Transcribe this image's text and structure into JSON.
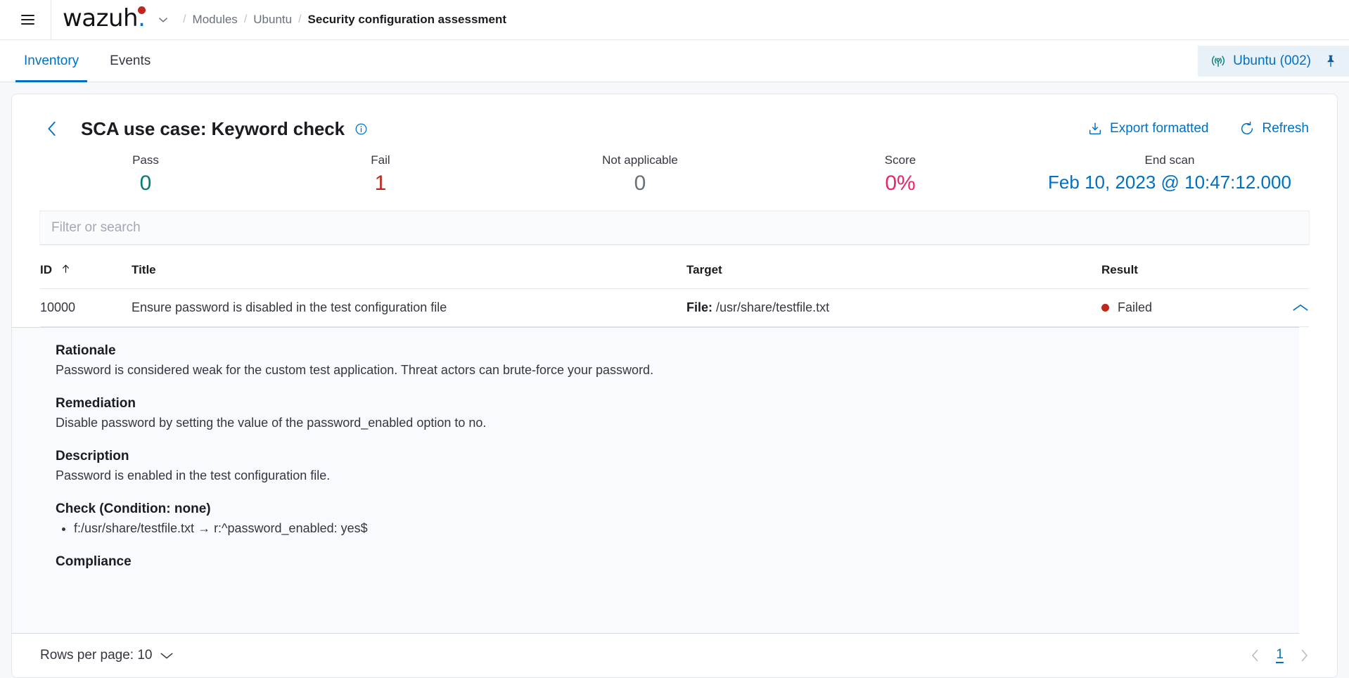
{
  "topbar": {
    "menu_icon": "hamburger-icon",
    "brand": "wazuh",
    "brand_dot": ".",
    "brand_caret_icon": "chevron-down-icon",
    "breadcrumbs": [
      {
        "label": "Modules",
        "current": false
      },
      {
        "label": "Ubuntu",
        "current": false
      },
      {
        "label": "Security configuration assessment",
        "current": true
      }
    ],
    "separator": "/"
  },
  "tabs": [
    {
      "label": "Inventory",
      "active": true
    },
    {
      "label": "Events",
      "active": false
    }
  ],
  "agent_pill": {
    "signal_icon": "antenna-signal-icon",
    "label": "Ubuntu (002)",
    "pin_icon": "pin-icon"
  },
  "page": {
    "back_icon": "chevron-left-icon",
    "title": "SCA use case: Keyword check",
    "info_icon": "info-circle-icon",
    "actions": [
      {
        "icon": "export-download-icon",
        "label": "Export formatted"
      },
      {
        "icon": "refresh-icon",
        "label": "Refresh"
      }
    ]
  },
  "stats": [
    {
      "label": "Pass",
      "value": "0",
      "color": "#017D73"
    },
    {
      "label": "Fail",
      "value": "1",
      "color": "#BD271E"
    },
    {
      "label": "Not applicable",
      "value": "0",
      "color": "#6A717D"
    },
    {
      "label": "Score",
      "value": "0%",
      "color": "#E7266B"
    },
    {
      "label": "End scan",
      "value": "Feb 10, 2023 @ 10:47:12.000",
      "color": "#0071C2"
    }
  ],
  "search": {
    "value": "",
    "placeholder": "Filter or search"
  },
  "table": {
    "columns": [
      {
        "key": "id",
        "label": "ID",
        "sorted": "asc",
        "sort_icon": "arrow-up-icon"
      },
      {
        "key": "title",
        "label": "Title"
      },
      {
        "key": "target",
        "label": "Target"
      },
      {
        "key": "result",
        "label": "Result"
      }
    ],
    "rows": [
      {
        "id": "10000",
        "title": "Ensure password is disabled in the test configuration file",
        "target_key": "File:",
        "target_value": "/usr/share/testfile.txt",
        "result": "Failed",
        "result_color": "#BD271E",
        "expanded": true,
        "expand_icon": "chevron-up-icon"
      }
    ]
  },
  "detail": {
    "sections": [
      {
        "heading": "Rationale",
        "text": "Password is considered weak for the custom test application. Threat actors can brute-force your password."
      },
      {
        "heading": "Remediation",
        "text": "Disable password by setting the value of the password_enabled option to no."
      },
      {
        "heading": "Description",
        "text": "Password is enabled in the test configuration file."
      }
    ],
    "check_heading": "Check (Condition: none)",
    "check_items": [
      "f:/usr/share/testfile.txt → r:^password_enabled: yes$"
    ],
    "compliance_heading": "Compliance"
  },
  "footer": {
    "rows_per_page_label": "Rows per page: 10",
    "rows_per_page_icon": "chevron-down-icon",
    "prev_icon": "chevron-left-icon",
    "next_icon": "chevron-right-icon",
    "current_page": "1"
  }
}
